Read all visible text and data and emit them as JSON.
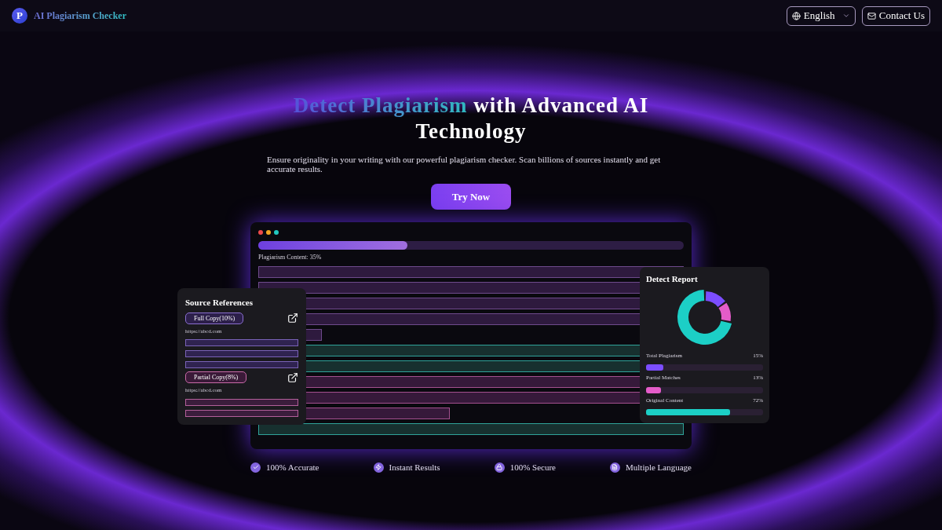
{
  "header": {
    "brand": {
      "logo_letter": "P",
      "name": "AI Plagiarism Checker"
    },
    "language": {
      "value": "English"
    },
    "contact": {
      "label": "Contact Us"
    }
  },
  "hero": {
    "title_highlight": "Detect Plagiarism",
    "title_rest": "with Advanced AI Technology",
    "subtitle": "Ensure originality in your writing with our powerful plagiarism checker. Scan billions of sources instantly and get accurate results.",
    "cta": "Try Now"
  },
  "preview": {
    "progress": {
      "level": 0.35,
      "label": "Plagiarism Content: 35%"
    },
    "rows": [
      {
        "kind": "plagiarism"
      },
      {
        "kind": "plagiarism"
      },
      {
        "kind": "plagiarism"
      },
      {
        "kind": "plagiarism"
      },
      {
        "kind": "stub"
      },
      {
        "kind": "original"
      },
      {
        "kind": "original"
      },
      {
        "kind": "partial"
      },
      {
        "kind": "partial"
      },
      {
        "kind": "tail"
      },
      {
        "kind": "original"
      }
    ],
    "sources": {
      "title": "Source References",
      "items": [
        {
          "kind": "full",
          "tag": "Full Copy(10%)",
          "url": "https://abcd.com",
          "lines": [
            {
              "kind": "full"
            },
            {
              "kind": "full"
            },
            {
              "kind": "full"
            }
          ]
        },
        {
          "kind": "partial",
          "tag": "Partial Copy(8%)",
          "url": "https://abcd.com",
          "lines": [
            {
              "kind": "partial"
            },
            {
              "kind": "partial"
            }
          ]
        }
      ]
    },
    "report": {
      "title": "Detect Report",
      "metrics": [
        {
          "label": "Total Plagiarism",
          "value": "15%",
          "level": 0.15,
          "color": "#7c4dff"
        },
        {
          "label": "Partial Matches",
          "value": "13%",
          "level": 0.13,
          "color": "#e45cc9"
        },
        {
          "label": "Original Content",
          "value": "72%",
          "level": 0.72,
          "color": "#1ccfc6"
        }
      ]
    }
  },
  "features": [
    {
      "kind": "check",
      "label": "100% Accurate"
    },
    {
      "kind": "bolt",
      "label": "Instant Results"
    },
    {
      "kind": "lock",
      "label": "100% Secure"
    },
    {
      "kind": "doc",
      "label": "Multiple Language"
    }
  ]
}
